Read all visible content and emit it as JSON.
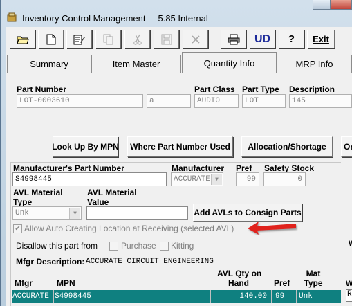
{
  "window": {
    "title": "Inventory Control Management",
    "version": "5.85 Internal"
  },
  "toolbar": {
    "open_icon": "folder-open-icon",
    "new_icon": "new-document-icon",
    "edit_icon": "edit-icon",
    "copy_icon": "copy-icon",
    "cut_icon": "cut-icon",
    "save_icon": "save-icon",
    "delete_icon": "delete-icon",
    "print_icon": "print-icon",
    "ud_label": "UD",
    "help_label": "?",
    "exit_label": "Exit"
  },
  "tabs": [
    {
      "label": "Summary"
    },
    {
      "label": "Item Master"
    },
    {
      "label": "Quantity Info"
    },
    {
      "label": "MRP Info"
    }
  ],
  "part": {
    "number_label": "Part Number",
    "number_value": "LOT-0003610",
    "revision_value": "a",
    "class_label": "Part Class",
    "class_value": "AUDIO",
    "type_label": "Part Type",
    "type_value": "LOT",
    "description_label": "Description",
    "description_value": "145"
  },
  "actions": {
    "lookup_mpn": "Look Up By MPN",
    "where_used": "Where Part Number Used",
    "allocation": "Allocation/Shortage",
    "more": "Or"
  },
  "avl": {
    "mpn_label": "Manufacturer's Part Number",
    "mpn_value": "S4998445",
    "manufacturer_label": "Manufacturer",
    "manufacturer_value": "ACCURATE",
    "pref_label": "Pref",
    "pref_value": "99",
    "safety_label": "Safety Stock",
    "safety_value": "0",
    "material_type_label_1": "AVL Material",
    "material_type_label_2": "Type",
    "material_type_value": "Unk",
    "material_value_label_1": "AVL Material",
    "material_value_label_2": "Value",
    "material_value_value": "",
    "consign_button": "Add AVLs to Consign Parts",
    "auto_create_label": "Allow Auto Creating Location at Receiving (selected AVL)",
    "auto_create_checked": true,
    "disallow_label": "Disallow this part from",
    "purchase_label": "Purchase",
    "kitting_label": "Kitting",
    "mfgr_desc_label": "Mfgr Description:",
    "mfgr_desc_value": "ACCURATE CIRCUIT ENGINEERING"
  },
  "grid": {
    "headers": {
      "mfgr": "Mfgr",
      "mpn": "MPN",
      "avl_qty_1": "AVL Qty on",
      "avl_qty_2": "Hand",
      "pref": "Pref",
      "mat_type_1": "Mat",
      "mat_type_2": "Type"
    },
    "rows": [
      {
        "mfgr": "ACCURATE",
        "mpn": "S4998445",
        "qty": "140.00",
        "pref": "99",
        "type": "Unk"
      }
    ]
  },
  "right_edge": {
    "w_label": "W",
    "r_label": "R",
    "w_lower": "W"
  },
  "colors": {
    "selected_row": "#0f8080",
    "arrow": "#e0201c"
  }
}
